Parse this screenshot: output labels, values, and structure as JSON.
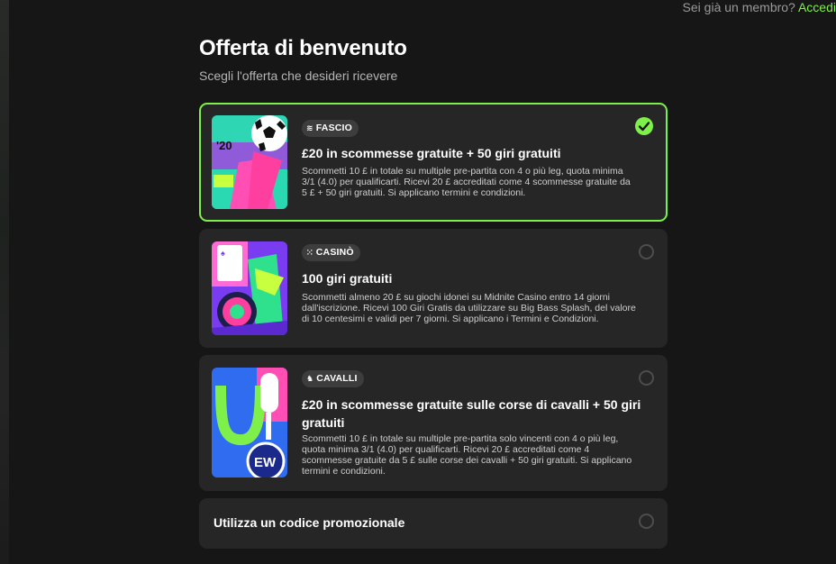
{
  "header": {
    "member_text": "Sei già un membro?",
    "login_link": "Accedi"
  },
  "page": {
    "title": "Offerta di benvenuto",
    "subtitle": "Scegli l'offerta che desideri ricevere"
  },
  "offers": [
    {
      "category": "FASCIO",
      "category_icon": "layers-icon",
      "title": "£20 in scommesse gratuite + 50 giri gratuiti",
      "description": "Scommetti 10 £ in totale su multiple pre-partita con 4 o più leg, quota minima 3/1 (4.0) per qualificarti. Ricevi 20 £ accreditati come 4 scommesse gratuite da 5 £ + 50 giri gratuiti. Si applicano termini e condizioni.",
      "thumb_label": "'20",
      "selected": true
    },
    {
      "category": "CASINÒ",
      "category_icon": "dice-icon",
      "title": "100 giri gratuiti",
      "description": "Scommetti almeno 20 £ su giochi idonei su Midnite Casino entro 14 giorni dall'iscrizione. Ricevi 100 Giri Gratis da utilizzare su Big Bass Splash, del valore di 10 centesimi e validi per 7 giorni. Si applicano i Termini e Condizioni.",
      "selected": false
    },
    {
      "category": "CAVALLI",
      "category_icon": "horse-icon",
      "title": "£20 in scommesse gratuite sulle corse di cavalli + 50 giri gratuiti",
      "description": "Scommetti 10 £ in totale su multiple pre-partita solo vincenti con 4 o più leg, quota minima 3/1 (4.0) per qualificarti. Ricevi 20 £ accreditati come 4 scommesse gratuite da 5 £ sulle corse dei cavalli + 50 giri gratuiti. Si applicano termini e condizioni.",
      "thumb_label": "EW",
      "selected": false
    }
  ],
  "promo": {
    "label": "Utilizza un codice promozionale"
  },
  "colors": {
    "accent": "#7ff04a",
    "background": "#161616",
    "card": "#262626"
  }
}
